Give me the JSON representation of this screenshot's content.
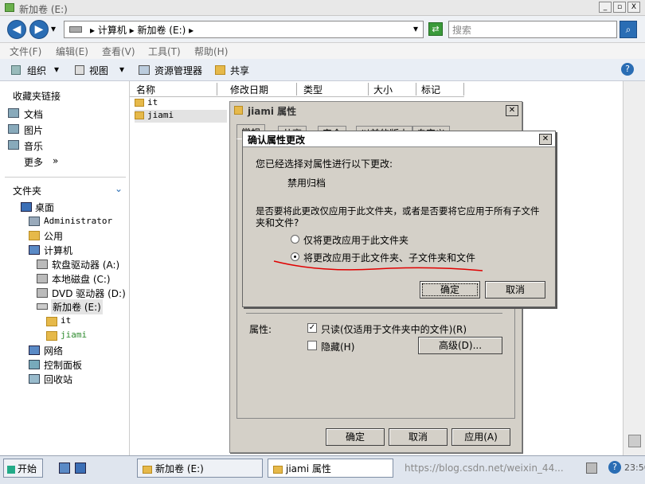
{
  "window": {
    "title": "新加卷 (E:)",
    "min": "_",
    "max": "▫",
    "close": "X"
  },
  "address": {
    "back": "◀",
    "forward": "▶",
    "path": "▸ 计算机 ▸ 新加卷 (E:) ▸",
    "dropdown": "▾",
    "search_placeholder": "搜索"
  },
  "menu": [
    "文件(F)",
    "编辑(E)",
    "查看(V)",
    "工具(T)",
    "帮助(H)"
  ],
  "toolbar": {
    "organize": "组织",
    "views": "视图",
    "explorer": "资源管理器",
    "share": "共享"
  },
  "sidebar": {
    "favorites_header": "收藏夹链接",
    "favorites": [
      "文档",
      "图片",
      "音乐"
    ],
    "more": "更多",
    "more_arrow": "»",
    "folders_header": "文件夹",
    "tree": [
      "桌面",
      "Administrator",
      "公用",
      "计算机",
      "软盘驱动器 (A:)",
      "本地磁盘 (C:)",
      "DVD 驱动器 (D:)",
      "新加卷 (E:)",
      "it",
      "jiami",
      "网络",
      "控制面板",
      "回收站"
    ]
  },
  "columns": [
    "名称",
    "修改日期",
    "类型",
    "大小",
    "标记"
  ],
  "files": [
    {
      "name": "it"
    },
    {
      "name": "jiami"
    }
  ],
  "props_dialog": {
    "title": "jiami 属性",
    "tabs": [
      "常规",
      "共享",
      "安全",
      "以前的版本",
      "自定义"
    ],
    "attr_label": "属性:",
    "readonly": "只读(仅适用于文件夹中的文件)(R)",
    "hidden": "隐藏(H)",
    "advanced": "高级(D)...",
    "ok": "确定",
    "cancel": "取消",
    "apply": "应用(A)"
  },
  "confirm_dialog": {
    "title": "确认属性更改",
    "intro": "您已经选择对属性进行以下更改:",
    "change": "禁用归档",
    "question_line1": "是否要将此更改仅应用于此文件夹，或者是否要将它应用于所有子文件",
    "question_line2": "夹和文件?",
    "option1": "仅将更改应用于此文件夹",
    "option2": "将更改应用于此文件夹、子文件夹和文件",
    "ok": "确定",
    "cancel": "取消"
  },
  "taskbar": {
    "start": "开始",
    "task1": "新加卷 (E:)",
    "task2": "jiami 属性",
    "watermark": "https://blog.csdn.net/weixin_44...",
    "clock": "23:50"
  },
  "colors": {
    "accent": "#2a6db4",
    "dialog_bg": "#d4d0c8",
    "annotation": "#e00000"
  }
}
